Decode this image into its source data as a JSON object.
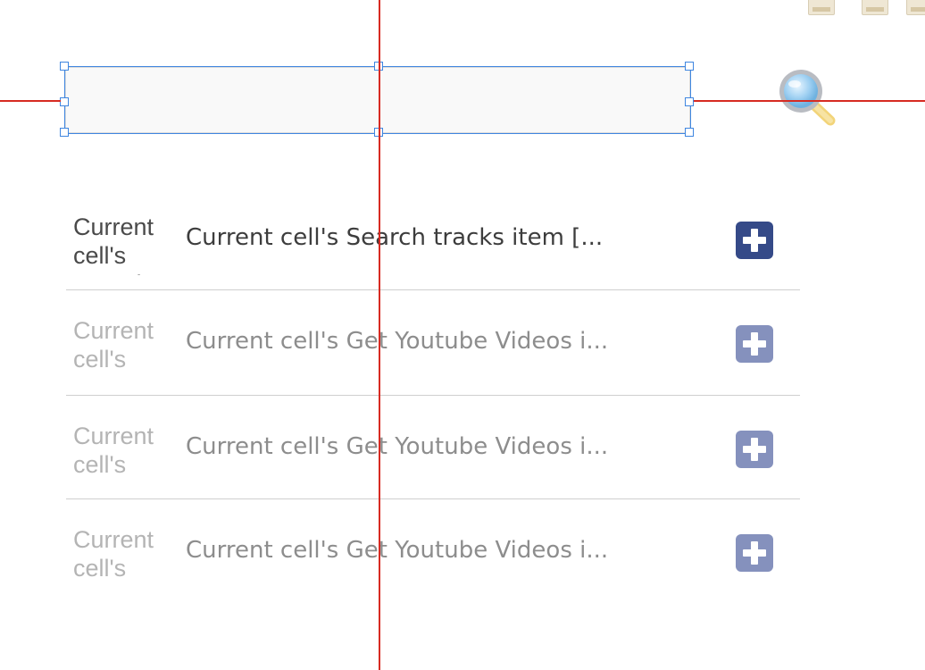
{
  "search": {
    "value": "",
    "placeholder": ""
  },
  "icons": {
    "search": "magnifier-icon",
    "add": "plus-icon"
  },
  "colors": {
    "selection": "#3f86e0",
    "guide": "#d72b22",
    "add_button_active": "#354a88",
    "add_button_dim": "#8591bd"
  },
  "list": {
    "items": [
      {
        "thumb_text": "Current cell's Search tracks",
        "title": "Current cell's Search tracks item [...",
        "state": "active"
      },
      {
        "thumb_text": "Current cell's Get Youtube",
        "title": "Current cell's Get Youtube Videos i...",
        "state": "dim"
      },
      {
        "thumb_text": "Current cell's Get Youtube",
        "title": "Current cell's Get Youtube Videos i...",
        "state": "dim"
      },
      {
        "thumb_text": "Current cell's Get Youtube",
        "title": "Current cell's Get Youtube Videos i...",
        "state": "dim"
      }
    ]
  }
}
